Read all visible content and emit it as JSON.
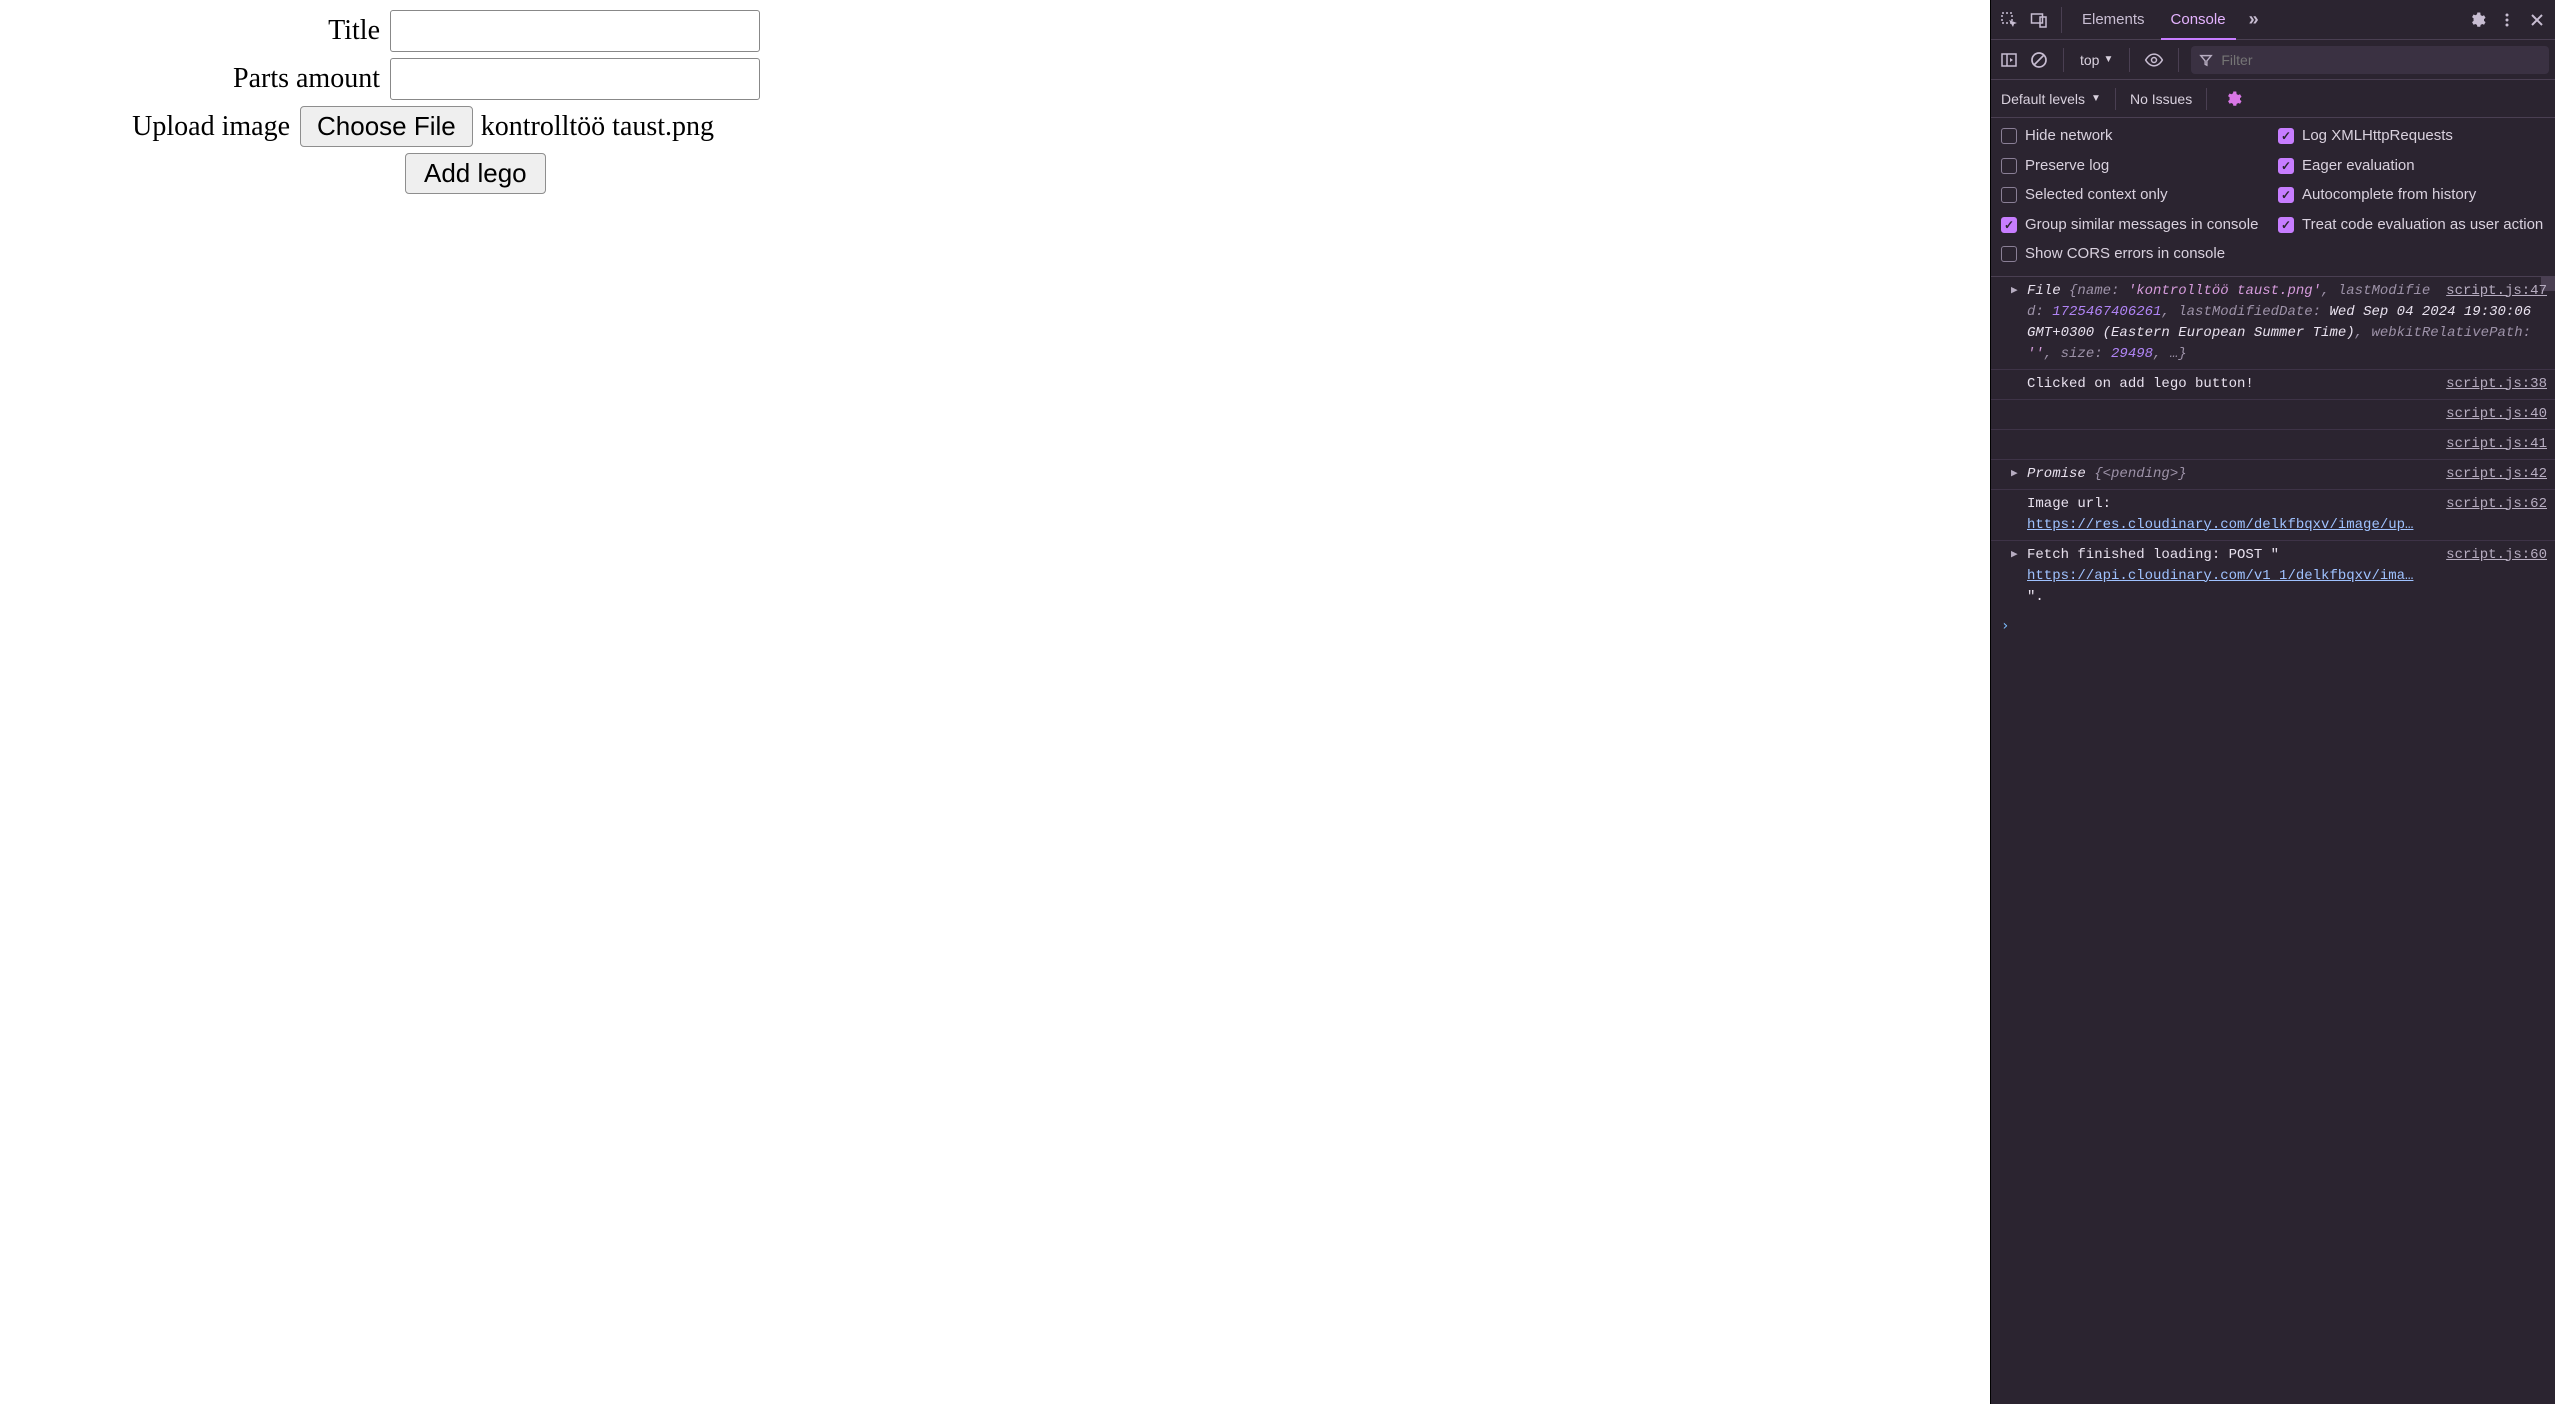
{
  "form": {
    "title_label": "Title",
    "parts_label": "Parts amount",
    "upload_label": "Upload image",
    "choose_file_label": "Choose File",
    "file_name": "kontrolltöö taust.png",
    "submit_label": "Add lego"
  },
  "devtools": {
    "tabs": {
      "elements": "Elements",
      "console": "Console"
    },
    "toolbar": {
      "context": "top",
      "filter_placeholder": "Filter"
    },
    "toolbar2": {
      "levels": "Default levels",
      "issues": "No Issues"
    },
    "settings": {
      "hide_network": "Hide network",
      "log_xhr": "Log XMLHttpRequests",
      "preserve_log": "Preserve log",
      "eager_eval": "Eager evaluation",
      "selected_ctx": "Selected context only",
      "autocomplete": "Autocomplete from history",
      "group_similar": "Group similar messages in console",
      "treat_code": "Treat code evaluation as user action",
      "show_cors": "Show CORS errors in console"
    },
    "log": {
      "r0_src": "script.js:47",
      "r0_text_prefix": "File ",
      "r0_name_key": "name: ",
      "r0_name_val": "'kontrolltöö taust.png'",
      "r0_lm_key": ", lastModified: ",
      "r0_lm_val": "1725467406261",
      "r0_lmd_key": ", lastModifiedDate: ",
      "r0_lmd_val": "Wed Sep 04 2024 19:30:06 GMT+0300 (Eastern European Summer Time)",
      "r0_wrp_key": ", webkitRelativePath: ",
      "r0_wrp_val": "''",
      "r0_size_key": ", size: ",
      "r0_size_val": "29498",
      "r0_tail": ", …}",
      "r1_text": "Clicked on add lego button!",
      "r1_src": "script.js:38",
      "r2_src": "script.js:40",
      "r3_src": "script.js:41",
      "r4_src": "script.js:42",
      "r4_prefix": "Promise ",
      "r4_body": "{<pending>}",
      "r5_src": "script.js:62",
      "r5_text": "Image url:",
      "r5_link": "https://res.cloudinary.com/delkfbqxv/image/up…",
      "r6_src": "script.js:60",
      "r6_prefix": "Fetch finished loading: POST \"",
      "r6_link": "https://api.cloudinary.com/v1_1/delkfbqxv/ima…",
      "r6_tail": "\"."
    }
  }
}
